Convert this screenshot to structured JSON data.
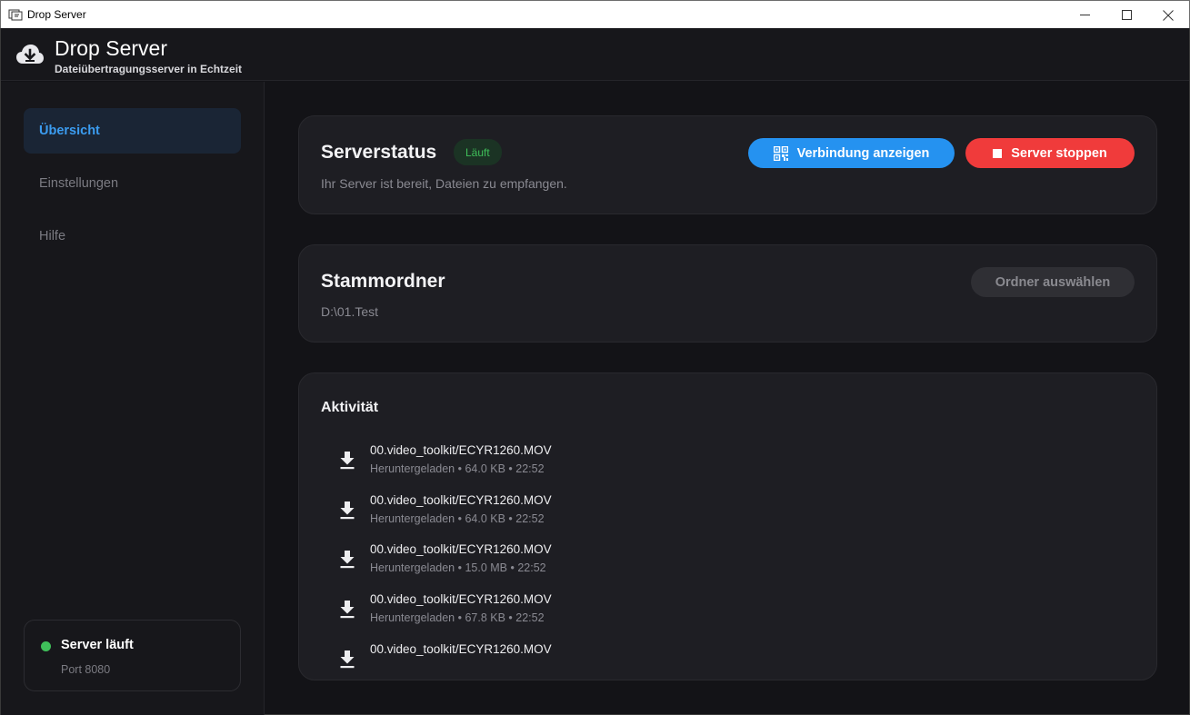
{
  "window": {
    "title": "Drop Server"
  },
  "header": {
    "title": "Drop Server",
    "subtitle": "Dateiübertragungsserver in Echtzeit",
    "logo_icon": "cloud-download-icon"
  },
  "sidebar": {
    "items": [
      {
        "label": "Übersicht",
        "active": true
      },
      {
        "label": "Einstellungen",
        "active": false
      },
      {
        "label": "Hilfe",
        "active": false
      }
    ],
    "status": {
      "title": "Server läuft",
      "port": "Port 8080"
    }
  },
  "server_status": {
    "title": "Serverstatus",
    "badge": "Läuft",
    "description": "Ihr Server ist bereit, Dateien zu empfangen.",
    "connect_button": "Verbindung anzeigen",
    "stop_button": "Server stoppen"
  },
  "root_folder": {
    "title": "Stammordner",
    "path": "D:\\01.Test",
    "select_button": "Ordner auswählen"
  },
  "activity": {
    "title": "Aktivität",
    "items": [
      {
        "name": "00.video_toolkit/ECYR1260.MOV",
        "meta": "Heruntergeladen • 64.0 KB • 22:52"
      },
      {
        "name": "00.video_toolkit/ECYR1260.MOV",
        "meta": "Heruntergeladen • 64.0 KB • 22:52"
      },
      {
        "name": "00.video_toolkit/ECYR1260.MOV",
        "meta": "Heruntergeladen • 15.0 MB • 22:52"
      },
      {
        "name": "00.video_toolkit/ECYR1260.MOV",
        "meta": "Heruntergeladen • 67.8 KB • 22:52"
      },
      {
        "name": "00.video_toolkit/ECYR1260.MOV",
        "meta": ""
      }
    ]
  },
  "colors": {
    "accent": "#2592f0",
    "danger": "#f03b3b",
    "success": "#3fbf5a",
    "background": "#131317",
    "card": "#1e1e23"
  }
}
